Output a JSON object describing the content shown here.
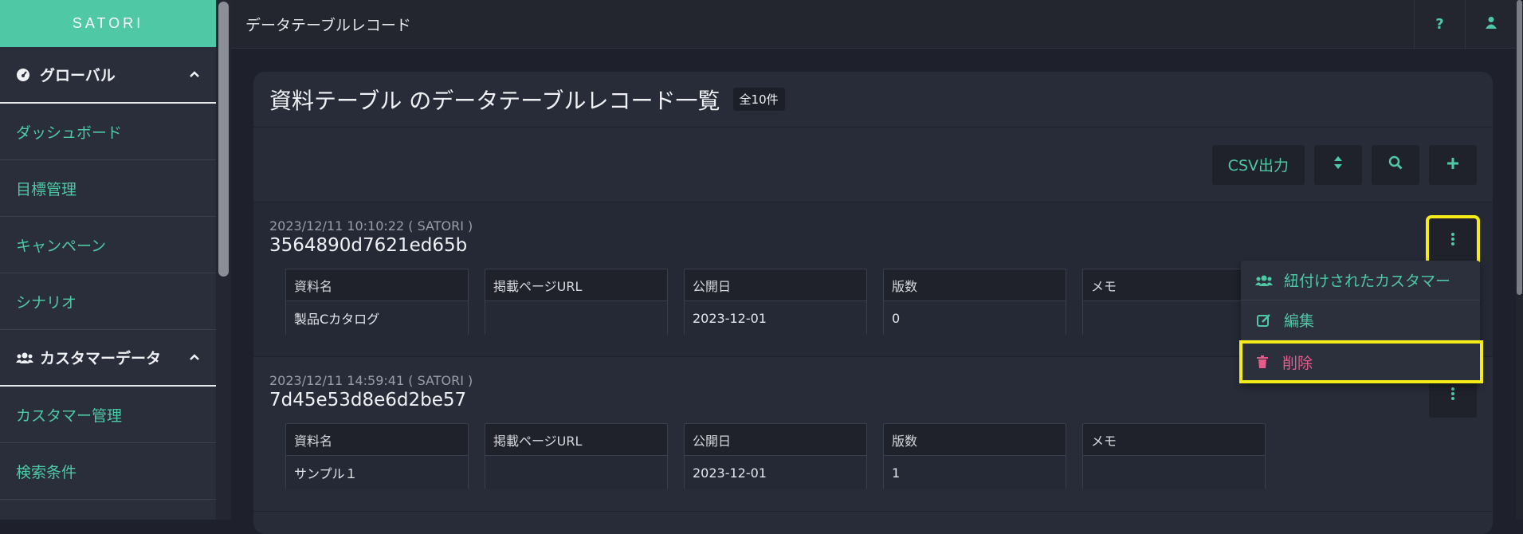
{
  "sidebar": {
    "brand": "SATORI",
    "group1": {
      "label": "グローバル",
      "icon": "dashboard-icon"
    },
    "group1_items": [
      "ダッシュボード",
      "目標管理",
      "キャンペーン",
      "シナリオ"
    ],
    "group2": {
      "label": "カスタマーデータ",
      "icon": "users-icon"
    },
    "group2_items": [
      "カスタマー管理",
      "検索条件"
    ]
  },
  "topbar": {
    "title": "データテーブルレコード",
    "help_label": "?"
  },
  "card": {
    "title": "資料テーブル のデータテーブルレコード一覧",
    "count": "全10件",
    "csv_label": "CSV出力"
  },
  "records": [
    {
      "meta": "2023/12/11 10:10:22 ( SATORI )",
      "id": "3564890d7621ed65b",
      "fields": [
        {
          "label": "資料名",
          "value": "製品Cカタログ"
        },
        {
          "label": "掲載ページURL",
          "value": ""
        },
        {
          "label": "公開日",
          "value": "2023-12-01"
        },
        {
          "label": "版数",
          "value": "0"
        },
        {
          "label": "メモ",
          "value": ""
        }
      ]
    },
    {
      "meta": "2023/12/11 14:59:41 ( SATORI )",
      "id": "7d45e53d8e6d2be57",
      "fields": [
        {
          "label": "資料名",
          "value": "サンプル１"
        },
        {
          "label": "掲載ページURL",
          "value": ""
        },
        {
          "label": "公開日",
          "value": "2023-12-01"
        },
        {
          "label": "版数",
          "value": "1"
        },
        {
          "label": "メモ",
          "value": ""
        }
      ]
    }
  ],
  "menu": {
    "linked_customers": "紐付けされたカスタマー",
    "edit": "編集",
    "delete": "削除"
  },
  "colors": {
    "accent": "#4ec8a5",
    "danger": "#e85a8a",
    "highlight": "#f5ec1a"
  }
}
